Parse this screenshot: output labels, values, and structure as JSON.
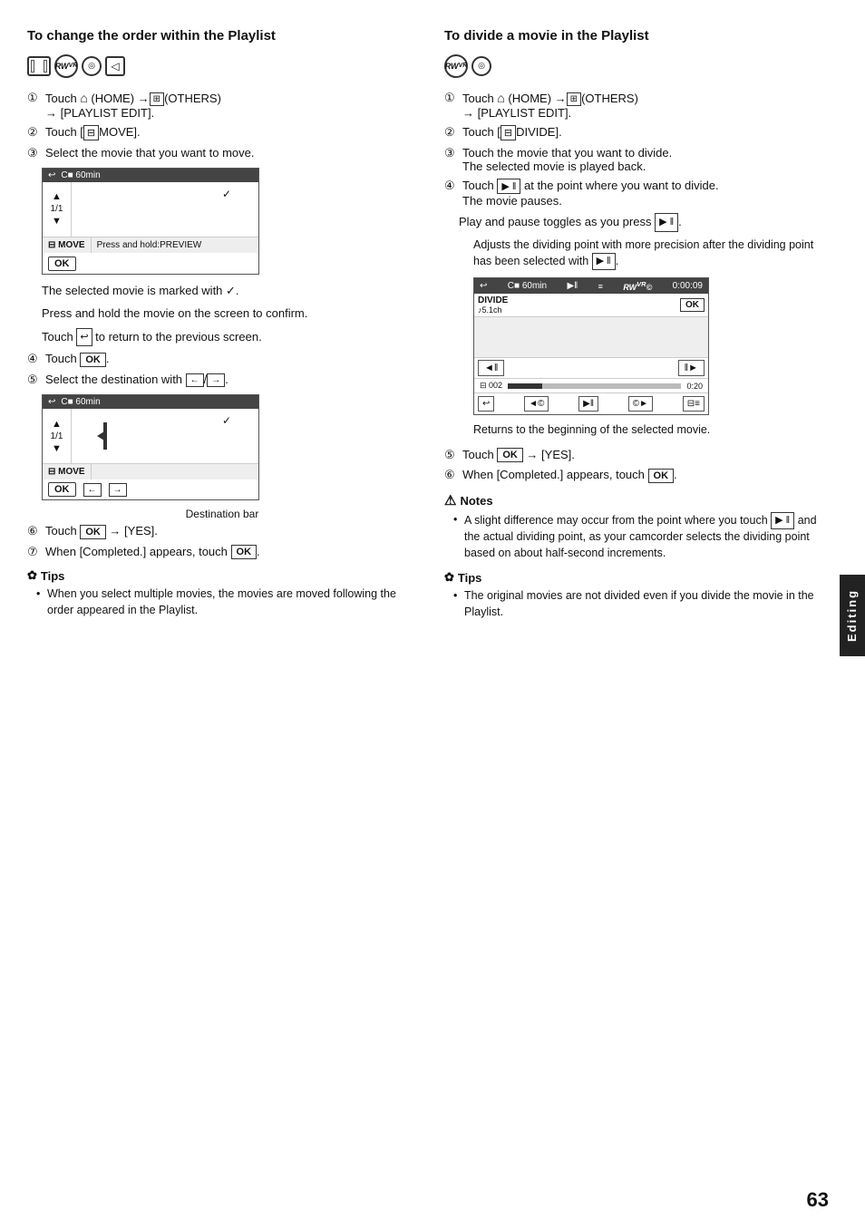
{
  "left_section": {
    "title": "To change the order within the Playlist",
    "steps": [
      {
        "num": "①",
        "text": "Touch",
        "home_sym": "⌂",
        "home_label": "(HOME) →",
        "others_label": "(OTHERS)",
        "arrow2": "→ [PLAYLIST EDIT]."
      },
      {
        "num": "②",
        "text": "Touch [MOVE]."
      },
      {
        "num": "③",
        "text": "Select the movie that you want to move."
      },
      {
        "num": "④",
        "text": "Touch",
        "ok_label": "OK",
        "suffix": "."
      },
      {
        "num": "⑤",
        "text": "Select the destination with",
        "suffix": "."
      },
      {
        "num": "⑥",
        "text": "Touch",
        "ok_label": "OK",
        "arrow": "→ [YES]."
      },
      {
        "num": "⑦",
        "text": "When [Completed.] appears, touch",
        "ok_label": "OK",
        "suffix": "."
      }
    ],
    "screen1": {
      "header": "C■ 60min",
      "nav_label": "1/1",
      "footer_left": "■ MOVE",
      "footer_right": "Press and hold:PREVIEW",
      "checkmark": "✓"
    },
    "screen2": {
      "header": "C■ 60min",
      "nav_label": "1/1",
      "footer_left": "■ MOVE",
      "dest_caption": "Destination bar"
    },
    "body_texts": [
      "The selected movie is marked with ✓.",
      "Press and hold the movie on the screen to confirm.",
      "Touch",
      "to return to the previous screen."
    ],
    "tips_title": "Tips",
    "tips": [
      "When you select multiple movies, the movies are moved following the order appeared in the Playlist."
    ]
  },
  "right_section": {
    "title": "To divide a movie in the Playlist",
    "steps": [
      {
        "num": "①",
        "text": "Touch",
        "home_sym": "⌂",
        "home_label": "(HOME) →",
        "others_label": "(OTHERS)",
        "arrow2": "→ [PLAYLIST EDIT]."
      },
      {
        "num": "②",
        "text": "Touch [DIVIDE]."
      },
      {
        "num": "③",
        "text": "Touch the movie that you want to divide.",
        "sub": "The selected movie is played back."
      },
      {
        "num": "④",
        "text": "Touch",
        "play_pause": "▶ ‖",
        "suffix": "at the point where you want to divide.",
        "sub": "The movie pauses."
      },
      {
        "num": "⑤",
        "text": "Touch",
        "ok_label": "OK",
        "arrow": "→ [YES]."
      },
      {
        "num": "⑥",
        "text": "When [Completed.] appears, touch",
        "ok_label": "OK",
        "suffix": "."
      }
    ],
    "play_pause_section": {
      "label": "Play and pause toggles as you press"
    },
    "adjusts_text": "Adjusts the dividing point with more precision after the dividing point has been selected with",
    "returns_text": "Returns to the beginning of the selected movie.",
    "divide_mockup": {
      "header_left": "■ C■ 60min",
      "header_mid": "▶‖",
      "header_right_label": "WVR©",
      "time": "0:00:09",
      "row1_left": "DIVIDE",
      "row1_sub": "♪5.1ch",
      "ok_btn": "OK",
      "nav_left": "◄‖",
      "nav_right": "‖►",
      "clip_num": "■ 002",
      "clip_time": "0:20"
    },
    "notes_title": "Notes",
    "notes": [
      "A slight difference may occur from the point where you touch",
      "and the actual dividing point, as your camcorder selects the dividing point based on about half-second increments."
    ],
    "tips_title": "Tips",
    "tips": [
      "The original movies are not divided even if you divide the movie in the Playlist."
    ]
  },
  "sidebar": {
    "label": "Editing"
  },
  "page_number": "63"
}
